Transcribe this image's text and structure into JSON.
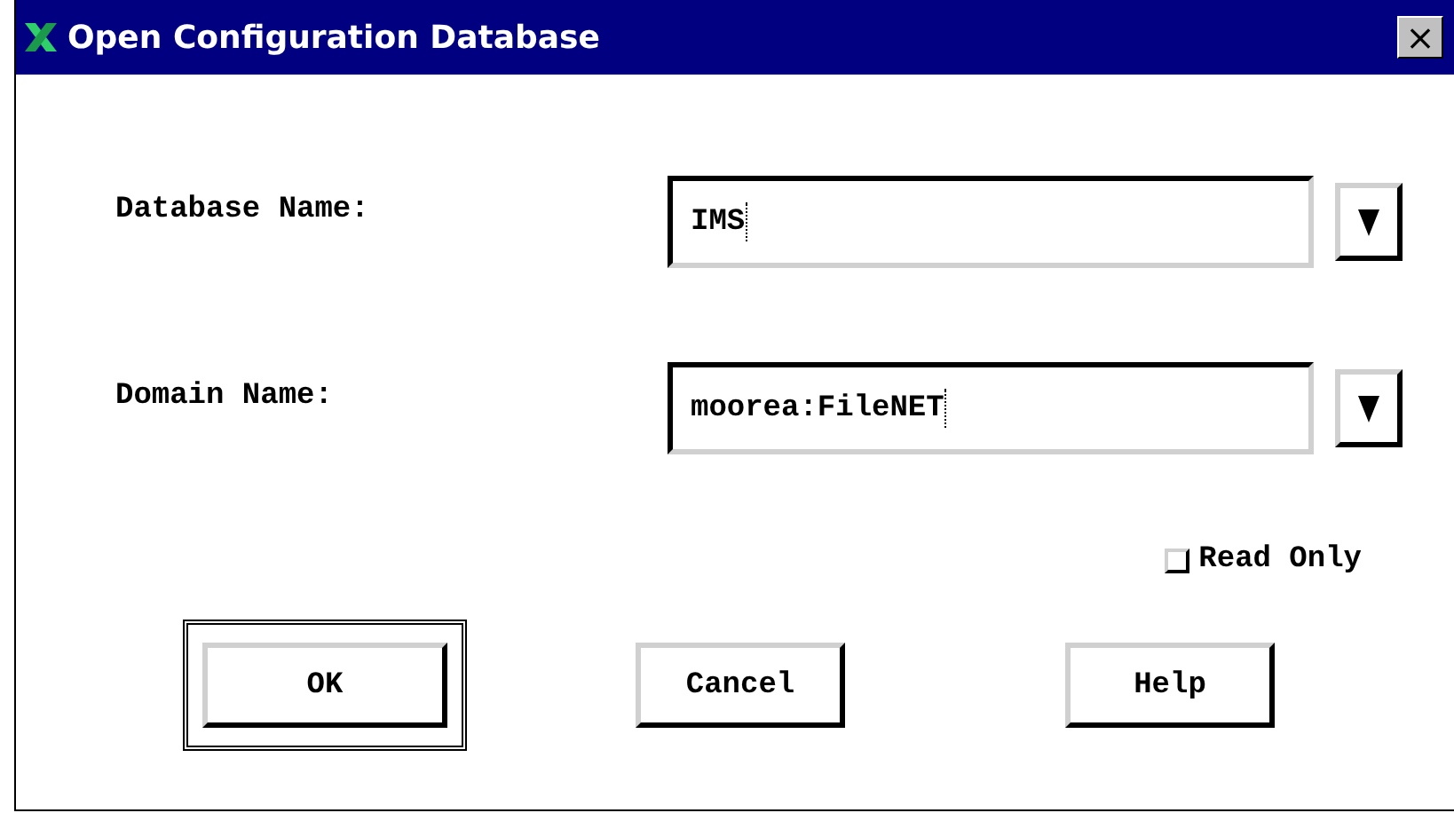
{
  "window": {
    "title": "Open Configuration Database",
    "close_label": "×"
  },
  "fields": [
    {
      "label": "Database Name:",
      "value": "IMS"
    },
    {
      "label": "Domain Name:",
      "value": "moorea:FileNET"
    }
  ],
  "read_only": {
    "label": "Read Only",
    "checked": false
  },
  "buttons": [
    {
      "label": "OK",
      "default": true
    },
    {
      "label": "Cancel",
      "default": false
    },
    {
      "label": "Help",
      "default": false
    }
  ]
}
